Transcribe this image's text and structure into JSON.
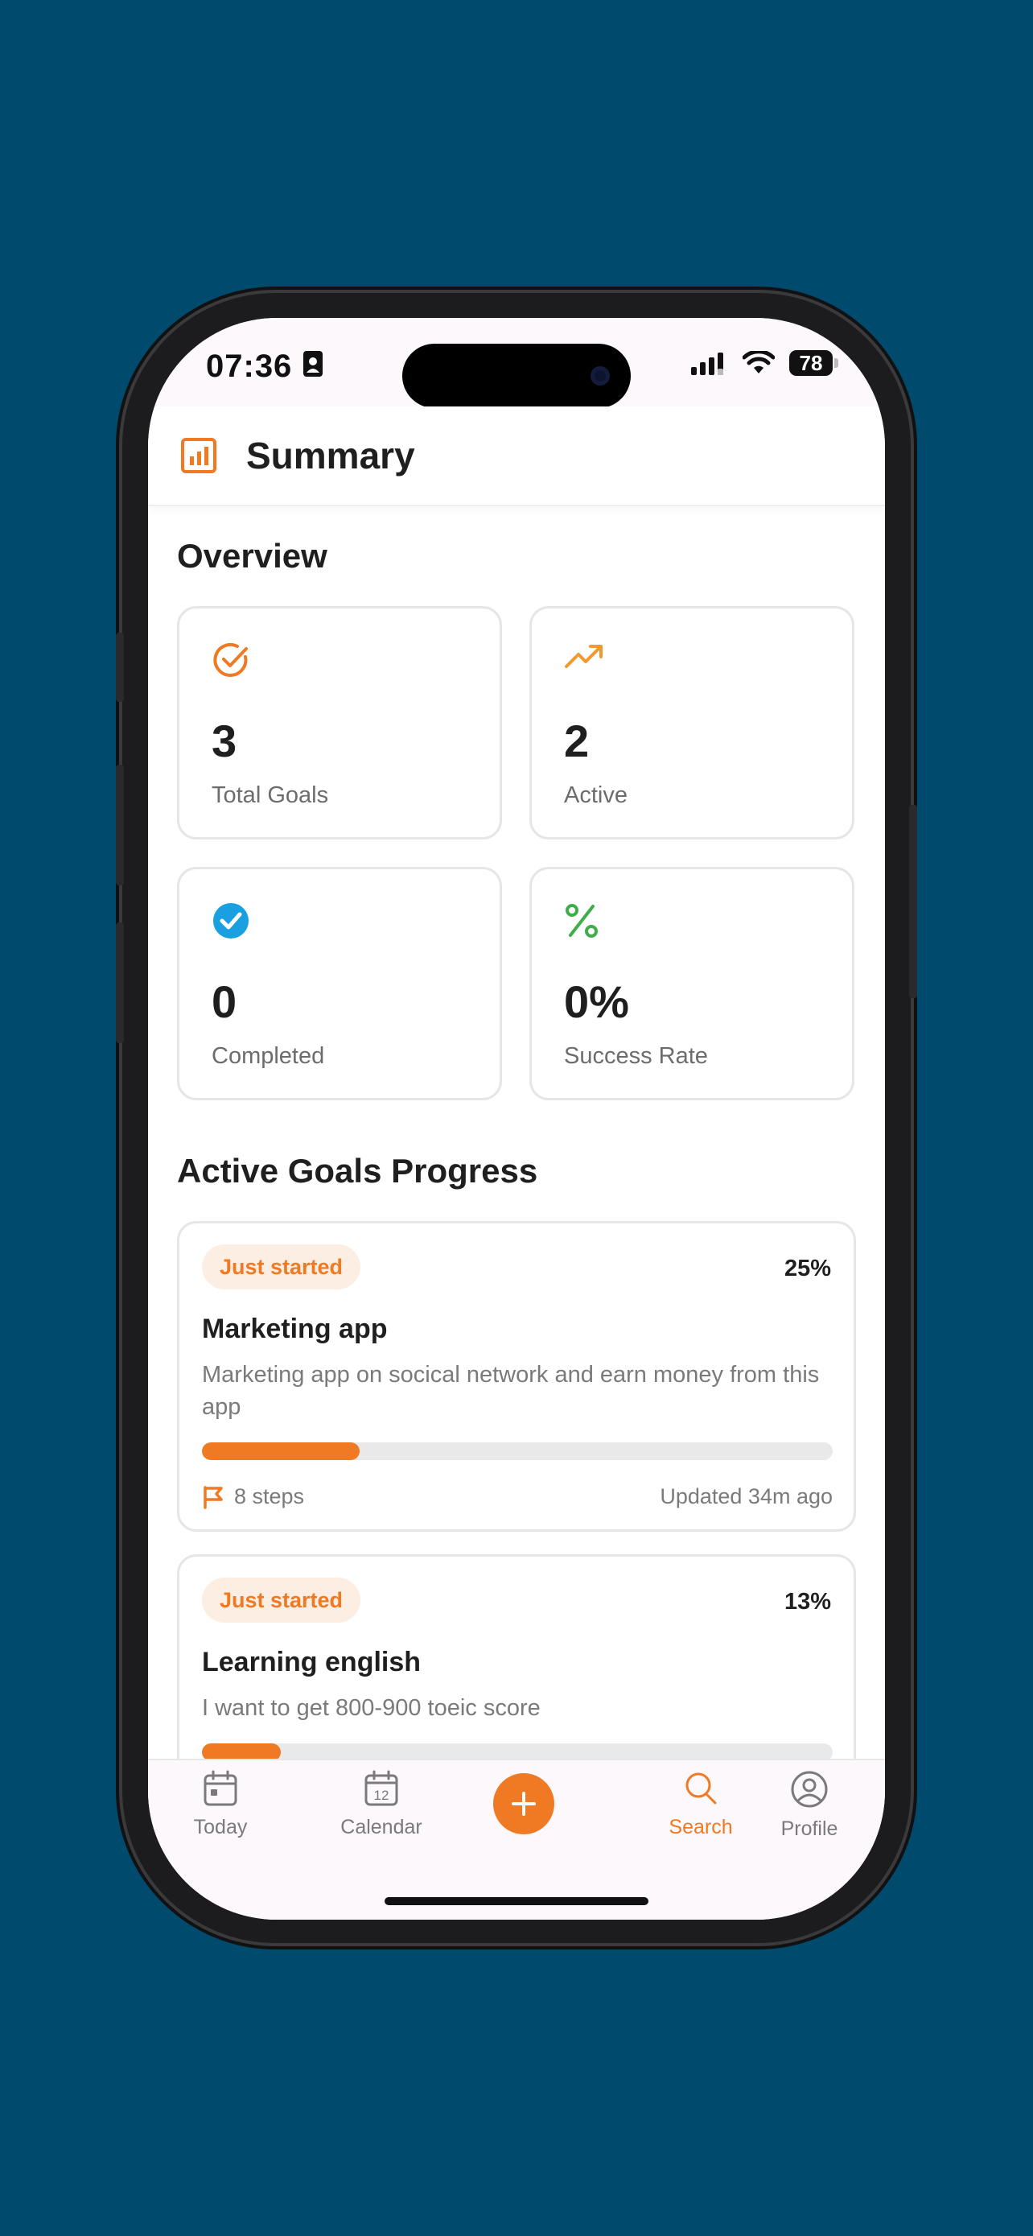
{
  "status_bar": {
    "time": "07:36",
    "battery": "78"
  },
  "header": {
    "title": "Summary",
    "icon": "bar-chart-icon"
  },
  "overview": {
    "title": "Overview",
    "stats": [
      {
        "value": "3",
        "label": "Total Goals",
        "icon": "check-circle-icon",
        "color": "#ef7a23"
      },
      {
        "value": "2",
        "label": "Active",
        "icon": "trending-up-icon",
        "color": "#f29a2e"
      },
      {
        "value": "0",
        "label": "Completed",
        "icon": "check-badge-icon",
        "color": "#1aa0e0"
      },
      {
        "value": "0%",
        "label": "Success Rate",
        "icon": "percent-icon",
        "color": "#3fae49"
      }
    ]
  },
  "active_goals": {
    "title": "Active Goals Progress",
    "goals": [
      {
        "status": "Just started",
        "percent": "25%",
        "progress": 0.25,
        "title": "Marketing app",
        "description": "Marketing app on socical network and earn money from this app",
        "steps": "8 steps",
        "updated": "Updated 34m ago"
      },
      {
        "status": "Just started",
        "percent": "13%",
        "progress": 0.125,
        "title": "Learning english",
        "description": "I want to get 800-900 toeic score"
      }
    ]
  },
  "tab_bar": {
    "tabs": [
      {
        "label": "Today",
        "icon": "calendar-day-icon"
      },
      {
        "label": "Calendar",
        "icon": "calendar-icon",
        "date": "12"
      },
      {
        "label": "",
        "icon": "plus-icon"
      },
      {
        "label": "Search",
        "icon": "search-icon",
        "active": true
      },
      {
        "label": "Profile",
        "icon": "user-circle-icon"
      }
    ]
  },
  "colors": {
    "accent": "#ef7a23",
    "background": "#004a6e"
  }
}
